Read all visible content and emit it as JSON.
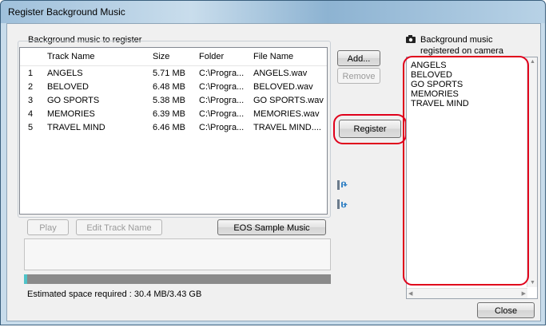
{
  "window": {
    "title": "Register Background Music"
  },
  "left_panel": {
    "group_label": "Background music to register",
    "columns": [
      "Track Name",
      "Size",
      "Folder",
      "File Name"
    ],
    "rows": [
      {
        "num": "1",
        "track": "ANGELS",
        "size": "5.71 MB",
        "folder": "C:\\Progra...",
        "file": "ANGELS.wav"
      },
      {
        "num": "2",
        "track": "BELOVED",
        "size": "6.48 MB",
        "folder": "C:\\Progra...",
        "file": "BELOVED.wav"
      },
      {
        "num": "3",
        "track": "GO SPORTS",
        "size": "5.38 MB",
        "folder": "C:\\Progra...",
        "file": "GO SPORTS.wav"
      },
      {
        "num": "4",
        "track": "MEMORIES",
        "size": "6.39 MB",
        "folder": "C:\\Progra...",
        "file": "MEMORIES.wav"
      },
      {
        "num": "5",
        "track": "TRAVEL MIND",
        "size": "6.46 MB",
        "folder": "C:\\Progra...",
        "file": "TRAVEL MIND...."
      }
    ],
    "play_label": "Play",
    "edit_track_label": "Edit Track Name",
    "eos_sample_label": "EOS Sample Music",
    "space_text": "Estimated space required : 30.4 MB/3.43 GB"
  },
  "middle": {
    "add_label": "Add...",
    "remove_label": "Remove",
    "register_label": "Register",
    "move_up_icon": "move-up-icon",
    "move_down_icon": "move-down-icon"
  },
  "right_panel": {
    "icon": "camera-icon",
    "label_line1": "Background music",
    "label_line2": "registered on camera",
    "items": [
      "ANGELS",
      "BELOVED",
      "GO SPORTS",
      "MEMORIES",
      "TRAVEL MIND"
    ],
    "close_label": "Close"
  },
  "colors": {
    "highlight_red": "#e0001b",
    "progress_fill": "#4fc3c8",
    "progress_track": "#8a8a8a"
  }
}
